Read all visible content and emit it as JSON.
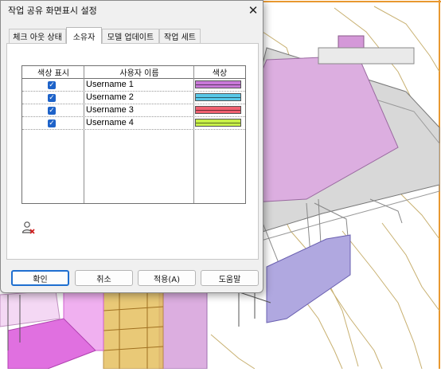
{
  "dialog": {
    "title": "작업 공유 화면표시 설정",
    "close_glyph": "✕",
    "tabs": [
      {
        "label": "체크 아웃 상태"
      },
      {
        "label": "소유자"
      },
      {
        "label": "모델 업데이트"
      },
      {
        "label": "작업 세트"
      }
    ],
    "active_tab_index": 1,
    "table": {
      "headers": [
        "색상 표시",
        "사용자 이름",
        "색상"
      ],
      "rows": [
        {
          "checked": true,
          "username": "Username 1",
          "color": "#c878d8"
        },
        {
          "checked": true,
          "username": "Username 2",
          "color": "#58c8e8"
        },
        {
          "checked": true,
          "username": "Username 3",
          "color": "#f06070"
        },
        {
          "checked": true,
          "username": "Username 4",
          "color": "#c8f048"
        }
      ]
    },
    "buttons": {
      "ok": "확인",
      "cancel": "취소",
      "apply": "적용(A)",
      "help": "도움말"
    }
  },
  "colors": {
    "dialog_bg": "#f0f0f0",
    "checkbox": "#1e63c9",
    "default_button_border": "#1f6fd0",
    "model_magenta": "#e070e0",
    "model_roof": "#dcaee0",
    "model_wall_blue": "#b0a8e0",
    "model_frame": "#c8a040",
    "model_orange": "#e89830"
  },
  "icons": {
    "checkbox": "checkmark-icon",
    "user_remove": "user-remove-icon",
    "close": "close-icon"
  }
}
